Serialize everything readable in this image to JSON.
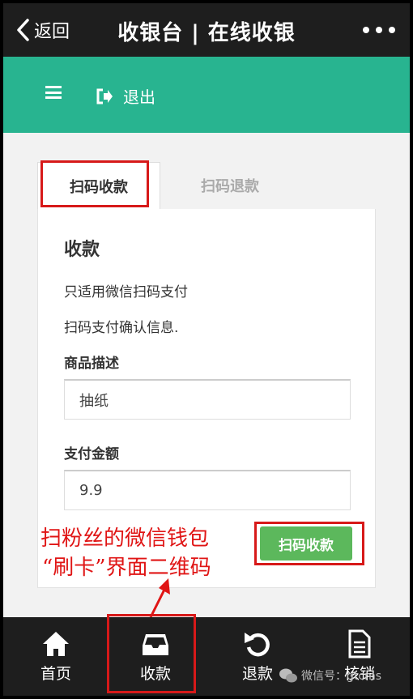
{
  "titlebar": {
    "back_label": "返回",
    "title": "收银台 | 在线收银"
  },
  "header": {
    "logout_label": "退出"
  },
  "tabs": [
    {
      "label": "扫码收款",
      "active": true
    },
    {
      "label": "扫码退款",
      "active": false
    }
  ],
  "form": {
    "title": "收款",
    "desc1": "只适用微信扫码支付",
    "desc2": "扫码支付确认信息.",
    "product_label": "商品描述",
    "product_value": "抽纸",
    "amount_label": "支付金额",
    "amount_value": "9.9",
    "submit_label": "扫码收款"
  },
  "annotation": {
    "line1": "扫粉丝的微信钱包",
    "line2": "“刷卡”界面二维码",
    "color": "#e01515"
  },
  "bottom_nav": [
    {
      "label": "首页",
      "icon": "home-icon"
    },
    {
      "label": "收款",
      "icon": "inbox-icon"
    },
    {
      "label": "退款",
      "icon": "refresh-icon"
    },
    {
      "label": "核销",
      "icon": "document-icon"
    }
  ],
  "watermark": {
    "text": "微信号：gtcms"
  },
  "colors": {
    "header_green": "#28b490",
    "button_green": "#5cb85c",
    "dark_bar": "#1e1e1e"
  }
}
